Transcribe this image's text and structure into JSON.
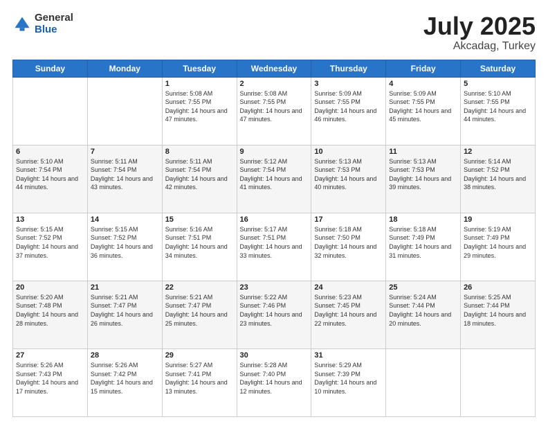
{
  "header": {
    "logo_general": "General",
    "logo_blue": "Blue",
    "title": "July 2025",
    "location": "Akcadag, Turkey"
  },
  "days_of_week": [
    "Sunday",
    "Monday",
    "Tuesday",
    "Wednesday",
    "Thursday",
    "Friday",
    "Saturday"
  ],
  "weeks": [
    [
      {
        "day": "",
        "info": ""
      },
      {
        "day": "",
        "info": ""
      },
      {
        "day": "1",
        "info": "Sunrise: 5:08 AM\nSunset: 7:55 PM\nDaylight: 14 hours and 47 minutes."
      },
      {
        "day": "2",
        "info": "Sunrise: 5:08 AM\nSunset: 7:55 PM\nDaylight: 14 hours and 47 minutes."
      },
      {
        "day": "3",
        "info": "Sunrise: 5:09 AM\nSunset: 7:55 PM\nDaylight: 14 hours and 46 minutes."
      },
      {
        "day": "4",
        "info": "Sunrise: 5:09 AM\nSunset: 7:55 PM\nDaylight: 14 hours and 45 minutes."
      },
      {
        "day": "5",
        "info": "Sunrise: 5:10 AM\nSunset: 7:55 PM\nDaylight: 14 hours and 44 minutes."
      }
    ],
    [
      {
        "day": "6",
        "info": "Sunrise: 5:10 AM\nSunset: 7:54 PM\nDaylight: 14 hours and 44 minutes."
      },
      {
        "day": "7",
        "info": "Sunrise: 5:11 AM\nSunset: 7:54 PM\nDaylight: 14 hours and 43 minutes."
      },
      {
        "day": "8",
        "info": "Sunrise: 5:11 AM\nSunset: 7:54 PM\nDaylight: 14 hours and 42 minutes."
      },
      {
        "day": "9",
        "info": "Sunrise: 5:12 AM\nSunset: 7:54 PM\nDaylight: 14 hours and 41 minutes."
      },
      {
        "day": "10",
        "info": "Sunrise: 5:13 AM\nSunset: 7:53 PM\nDaylight: 14 hours and 40 minutes."
      },
      {
        "day": "11",
        "info": "Sunrise: 5:13 AM\nSunset: 7:53 PM\nDaylight: 14 hours and 39 minutes."
      },
      {
        "day": "12",
        "info": "Sunrise: 5:14 AM\nSunset: 7:52 PM\nDaylight: 14 hours and 38 minutes."
      }
    ],
    [
      {
        "day": "13",
        "info": "Sunrise: 5:15 AM\nSunset: 7:52 PM\nDaylight: 14 hours and 37 minutes."
      },
      {
        "day": "14",
        "info": "Sunrise: 5:15 AM\nSunset: 7:52 PM\nDaylight: 14 hours and 36 minutes."
      },
      {
        "day": "15",
        "info": "Sunrise: 5:16 AM\nSunset: 7:51 PM\nDaylight: 14 hours and 34 minutes."
      },
      {
        "day": "16",
        "info": "Sunrise: 5:17 AM\nSunset: 7:51 PM\nDaylight: 14 hours and 33 minutes."
      },
      {
        "day": "17",
        "info": "Sunrise: 5:18 AM\nSunset: 7:50 PM\nDaylight: 14 hours and 32 minutes."
      },
      {
        "day": "18",
        "info": "Sunrise: 5:18 AM\nSunset: 7:49 PM\nDaylight: 14 hours and 31 minutes."
      },
      {
        "day": "19",
        "info": "Sunrise: 5:19 AM\nSunset: 7:49 PM\nDaylight: 14 hours and 29 minutes."
      }
    ],
    [
      {
        "day": "20",
        "info": "Sunrise: 5:20 AM\nSunset: 7:48 PM\nDaylight: 14 hours and 28 minutes."
      },
      {
        "day": "21",
        "info": "Sunrise: 5:21 AM\nSunset: 7:47 PM\nDaylight: 14 hours and 26 minutes."
      },
      {
        "day": "22",
        "info": "Sunrise: 5:21 AM\nSunset: 7:47 PM\nDaylight: 14 hours and 25 minutes."
      },
      {
        "day": "23",
        "info": "Sunrise: 5:22 AM\nSunset: 7:46 PM\nDaylight: 14 hours and 23 minutes."
      },
      {
        "day": "24",
        "info": "Sunrise: 5:23 AM\nSunset: 7:45 PM\nDaylight: 14 hours and 22 minutes."
      },
      {
        "day": "25",
        "info": "Sunrise: 5:24 AM\nSunset: 7:44 PM\nDaylight: 14 hours and 20 minutes."
      },
      {
        "day": "26",
        "info": "Sunrise: 5:25 AM\nSunset: 7:44 PM\nDaylight: 14 hours and 18 minutes."
      }
    ],
    [
      {
        "day": "27",
        "info": "Sunrise: 5:26 AM\nSunset: 7:43 PM\nDaylight: 14 hours and 17 minutes."
      },
      {
        "day": "28",
        "info": "Sunrise: 5:26 AM\nSunset: 7:42 PM\nDaylight: 14 hours and 15 minutes."
      },
      {
        "day": "29",
        "info": "Sunrise: 5:27 AM\nSunset: 7:41 PM\nDaylight: 14 hours and 13 minutes."
      },
      {
        "day": "30",
        "info": "Sunrise: 5:28 AM\nSunset: 7:40 PM\nDaylight: 14 hours and 12 minutes."
      },
      {
        "day": "31",
        "info": "Sunrise: 5:29 AM\nSunset: 7:39 PM\nDaylight: 14 hours and 10 minutes."
      },
      {
        "day": "",
        "info": ""
      },
      {
        "day": "",
        "info": ""
      }
    ]
  ]
}
